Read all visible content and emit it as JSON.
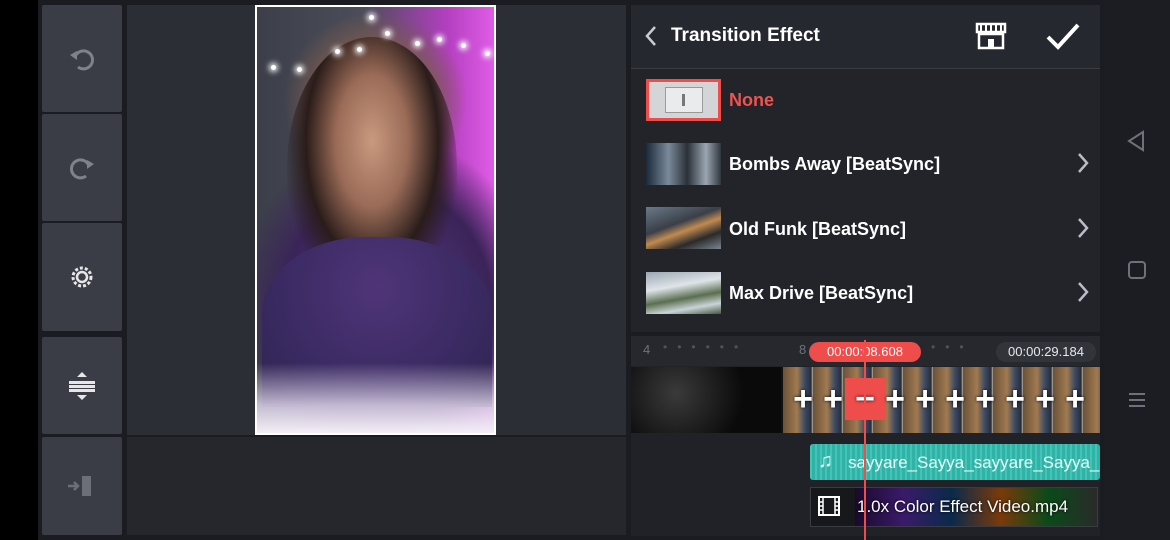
{
  "panel": {
    "title": "Transition Effect",
    "icons": [
      "back-chevron-icon",
      "store-icon",
      "checkmark-icon"
    ]
  },
  "transitions": [
    {
      "label": "None",
      "selected": true,
      "color": "#ef5350"
    },
    {
      "label": "Bombs Away [BeatSync]"
    },
    {
      "label": "Old Funk [BeatSync]"
    },
    {
      "label": "Max Drive [BeatSync]"
    }
  ],
  "timeline": {
    "ruler_left": "4",
    "ruler_mid": "8",
    "current_time": "00:00:08.608",
    "total_time": "00:00:29.184",
    "plus_symbol": "+",
    "minus_symbol": "−",
    "audio_track": "sayyare_Sayya_sayyare_Sayya_",
    "video_layer": "1.0x Color Effect Video.mp4"
  },
  "tools": [
    "undo-icon",
    "redo-icon",
    "settings-icon",
    "split-adjust-icon",
    "exit-icon"
  ],
  "colors": {
    "accent": "#ef4c4c",
    "audio": "#2fb3a6",
    "panel": "#22242a"
  }
}
